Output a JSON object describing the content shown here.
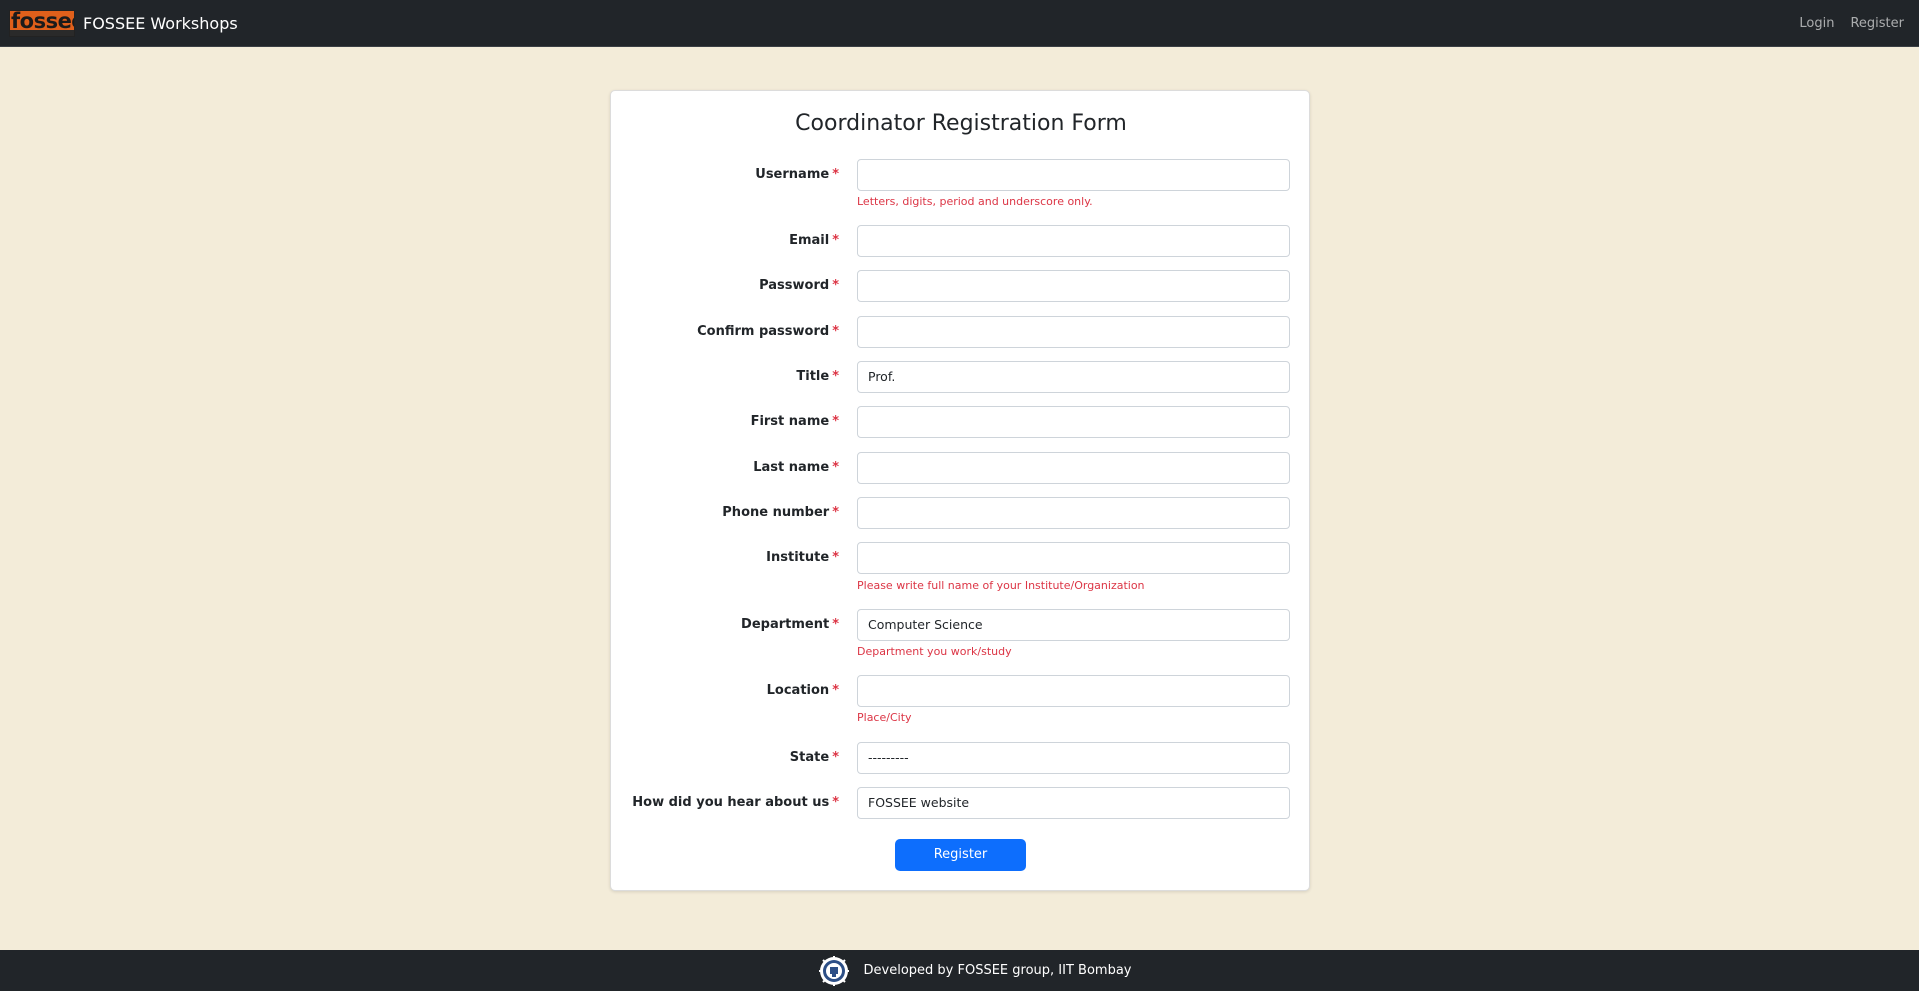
{
  "navbar": {
    "logo_text": "fossee",
    "brand": "FOSSEE Workshops",
    "links": [
      "Login",
      "Register"
    ]
  },
  "form": {
    "title": "Coordinator Registration Form",
    "required_marker": "*",
    "fields": [
      {
        "label": "Username",
        "value": "",
        "help": "Letters, digits, period and underscore only."
      },
      {
        "label": "Email",
        "value": ""
      },
      {
        "label": "Password",
        "value": ""
      },
      {
        "label": "Confirm password",
        "value": ""
      },
      {
        "label": "Title",
        "value": "Prof."
      },
      {
        "label": "First name",
        "value": ""
      },
      {
        "label": "Last name",
        "value": ""
      },
      {
        "label": "Phone number",
        "value": ""
      },
      {
        "label": "Institute",
        "value": "",
        "help": "Please write full name of your Institute/Organization"
      },
      {
        "label": "Department",
        "value": "Computer Science",
        "help": "Department you work/study"
      },
      {
        "label": "Location",
        "value": "",
        "help": "Place/City"
      },
      {
        "label": "State",
        "value": "---------"
      },
      {
        "label": "How did you hear about us",
        "value": "FOSSEE website"
      }
    ],
    "submit_label": "Register"
  },
  "footer": {
    "text": "Developed by FOSSEE group, IIT Bombay"
  },
  "colors": {
    "page_background": "#f3ecd9",
    "navbar": "#212529",
    "accent": "#0d6efd",
    "error_text": "#dc3545",
    "logo_orange": "#e0601b"
  }
}
